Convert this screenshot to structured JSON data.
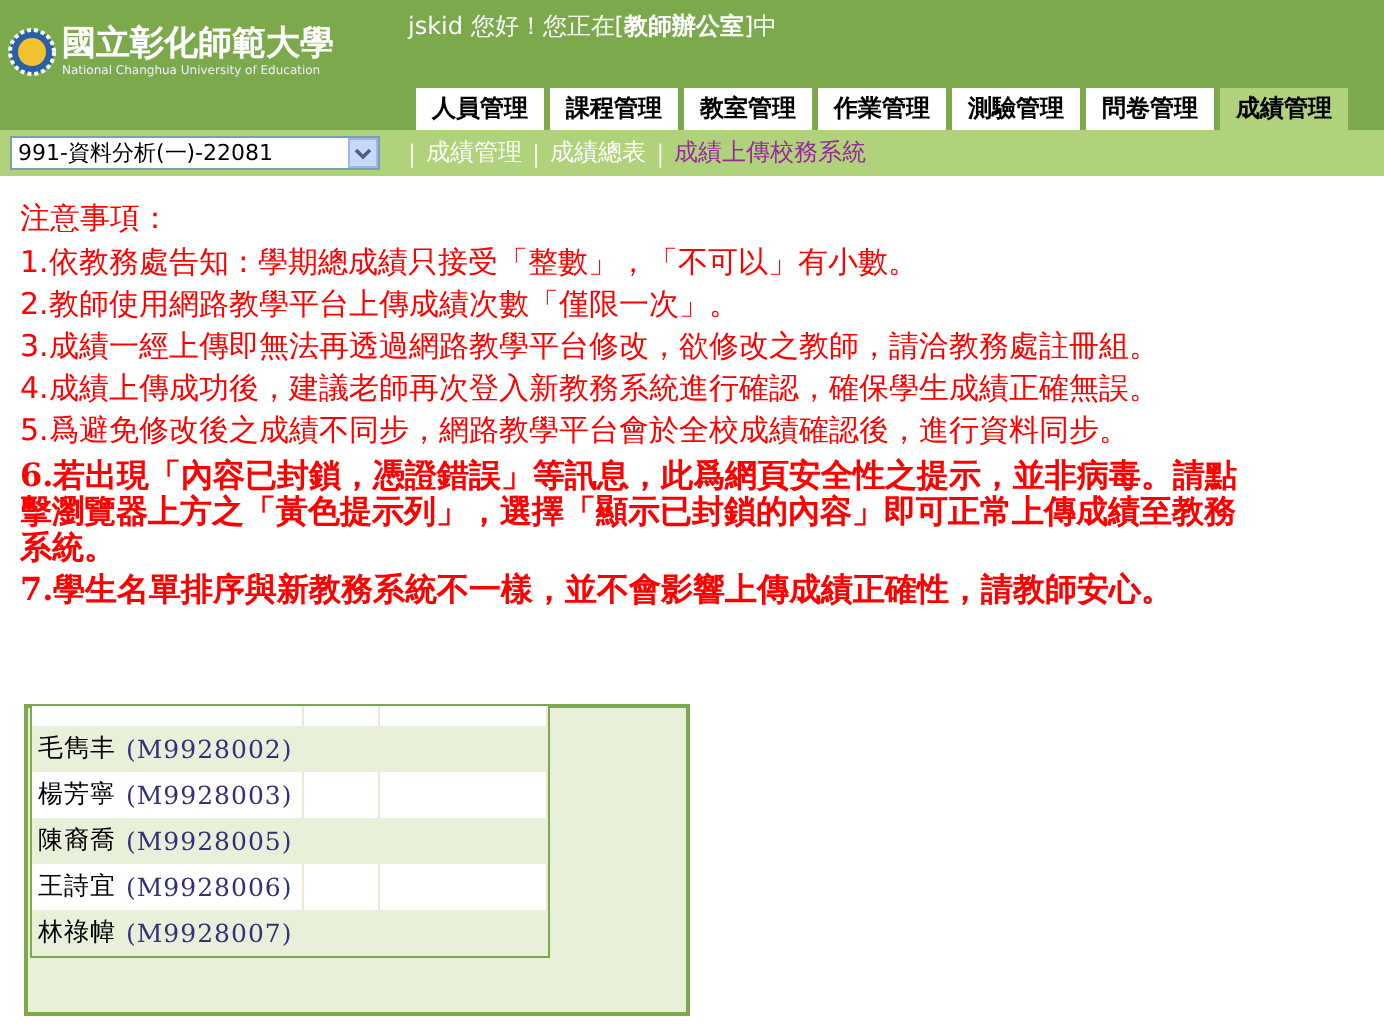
{
  "header": {
    "logo_title": "國立彰化師範大學",
    "logo_subtitle": "National Changhua University of Education",
    "greeting": "jskid 您好！您正在[**教師辦公室**]中"
  },
  "tabs": [
    {
      "label": "人員管理",
      "selected": false
    },
    {
      "label": "課程管理",
      "selected": false
    },
    {
      "label": "教室管理",
      "selected": false
    },
    {
      "label": "作業管理",
      "selected": false
    },
    {
      "label": "測驗管理",
      "selected": false
    },
    {
      "label": "問卷管理",
      "selected": false
    },
    {
      "label": "成績管理",
      "selected": true
    }
  ],
  "course_select": {
    "value": "991-資料分析(一)-22081"
  },
  "sub_links": [
    {
      "label": "成績管理",
      "selected": false
    },
    {
      "label": "成績總表",
      "selected": false
    },
    {
      "label": "成績上傳校務系統",
      "selected": true
    }
  ],
  "sub_link_separator": "|",
  "notice": {
    "title": "注意事項：",
    "items": [
      {
        "kind": "normal",
        "number": "1.",
        "text": "依教務處告知 : 學期總成績只接受「整數」，「不可以」有小數。"
      },
      {
        "kind": "normal",
        "number": "2.",
        "text": "教師使用網路教學平台上傳成績次數「僅限一次」。"
      },
      {
        "kind": "normal",
        "number": "3.",
        "text": "成績一經上傳即無法再透過網路教學平台修改，欲修改之教師，請洽教務處註冊組。"
      },
      {
        "kind": "normal",
        "number": "4.",
        "text": "成績上傳成功後，建議老師再次登入新教務系統進行確認，確保學生成績正確無誤。"
      },
      {
        "kind": "normal",
        "number": "5.",
        "text": "爲避免修改後之成績不同步，網路教學平台會於全校成績確認後，進行資料同步。"
      },
      {
        "kind": "bold",
        "number": "6.",
        "text": "若出現「內容已封鎖，憑證錯誤」等訊息，此爲網頁安全性之提示，並非病毒。請點擊瀏覽器上方之「黃色提示列」，選擇「顯示已封鎖的內容」即可正常上傳成績至教務系統。"
      },
      {
        "kind": "bold",
        "number": "7.",
        "text": "學生名單排序與新教務系統不一樣，並不會影響上傳成績正確性，請教師安心。"
      }
    ]
  },
  "students": [
    {
      "name": "毛雋丰",
      "id": "(M9928002)"
    },
    {
      "name": "楊芳寧",
      "id": "(M9928003)"
    },
    {
      "name": "陳裔喬",
      "id": "(M9928005)"
    },
    {
      "name": "王詩宜",
      "id": "(M9928006)"
    },
    {
      "name": "林祿幃",
      "id": "(M9928007)"
    }
  ]
}
